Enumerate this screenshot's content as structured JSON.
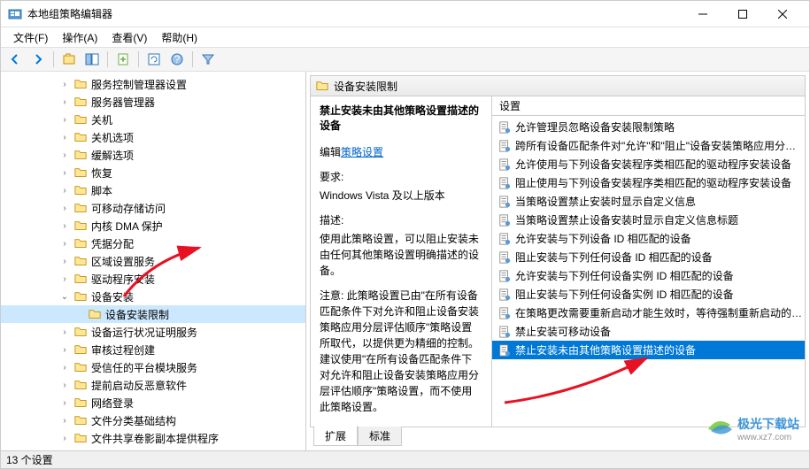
{
  "window": {
    "title": "本地组策略编辑器"
  },
  "menubar": {
    "file": "文件(F)",
    "action": "操作(A)",
    "view": "查看(V)",
    "help": "帮助(H)"
  },
  "tree": {
    "items": [
      {
        "label": "服务控制管理器设置",
        "indent": 4
      },
      {
        "label": "服务器管理器",
        "indent": 4
      },
      {
        "label": "关机",
        "indent": 4
      },
      {
        "label": "关机选项",
        "indent": 4
      },
      {
        "label": "缓解选项",
        "indent": 4
      },
      {
        "label": "恢复",
        "indent": 4
      },
      {
        "label": "脚本",
        "indent": 4
      },
      {
        "label": "可移动存储访问",
        "indent": 4
      },
      {
        "label": "内核 DMA 保护",
        "indent": 4
      },
      {
        "label": "凭据分配",
        "indent": 4
      },
      {
        "label": "区域设置服务",
        "indent": 4
      },
      {
        "label": "驱动程序安装",
        "indent": 4
      },
      {
        "label": "设备安装",
        "indent": 4,
        "expanded": true
      },
      {
        "label": "设备安装限制",
        "indent": 5,
        "selected": true
      },
      {
        "label": "设备运行状况证明服务",
        "indent": 4
      },
      {
        "label": "审核过程创建",
        "indent": 4
      },
      {
        "label": "受信任的平台模块服务",
        "indent": 4
      },
      {
        "label": "提前启动反恶意软件",
        "indent": 4
      },
      {
        "label": "网络登录",
        "indent": 4
      },
      {
        "label": "文件分类基础结构",
        "indent": 4
      },
      {
        "label": "文件共享卷影副本提供程序",
        "indent": 4
      }
    ]
  },
  "right": {
    "header": "设备安装限制",
    "desc": {
      "title": "禁止安装未由其他策略设置描述的设备",
      "edit_label": "编辑",
      "edit_link": "策略设置",
      "req_label": "要求:",
      "req_value": "Windows Vista 及以上版本",
      "desc_label": "描述:",
      "desc_value": "使用此策略设置，可以阻止安装未由任何其他策略设置明确描述的设备。",
      "note_value": "注意: 此策略设置已由\"在所有设备匹配条件下对允许和阻止设备安装策略应用分层评估顺序\"策略设置所取代，以提供更为精细的控制。建议使用\"在所有设备匹配条件下对允许和阻止设备安装策略应用分层评估顺序\"策略设置，而不使用此策略设置。"
    },
    "settings": {
      "header": "设置",
      "items": [
        "允许管理员忽略设备安装限制策略",
        "跨所有设备匹配条件对\"允许\"和\"阻止\"设备安装策略应用分…",
        "允许使用与下列设备安装程序类相匹配的驱动程序安装设备",
        "阻止使用与下列设备安装程序类相匹配的驱动程序安装设备",
        "当策略设置禁止安装时显示自定义信息",
        "当策略设置禁止设备安装时显示自定义信息标题",
        "允许安装与下列设备 ID 相匹配的设备",
        "阻止安装与下列任何设备 ID 相匹配的设备",
        "允许安装与下列任何设备实例 ID 相匹配的设备",
        "阻止安装与下列任何设备实例 ID 相匹配的设备",
        "在策略更改需要重新启动才能生效时，等待强制重新启动的…",
        "禁止安装可移动设备",
        "禁止安装未由其他策略设置描述的设备"
      ],
      "selected_index": 12
    },
    "tabs": {
      "extended": "扩展",
      "standard": "标准"
    }
  },
  "statusbar": {
    "text": "13 个设置"
  },
  "watermark": {
    "name": "极光下载站",
    "url": "www.xz7.com"
  }
}
